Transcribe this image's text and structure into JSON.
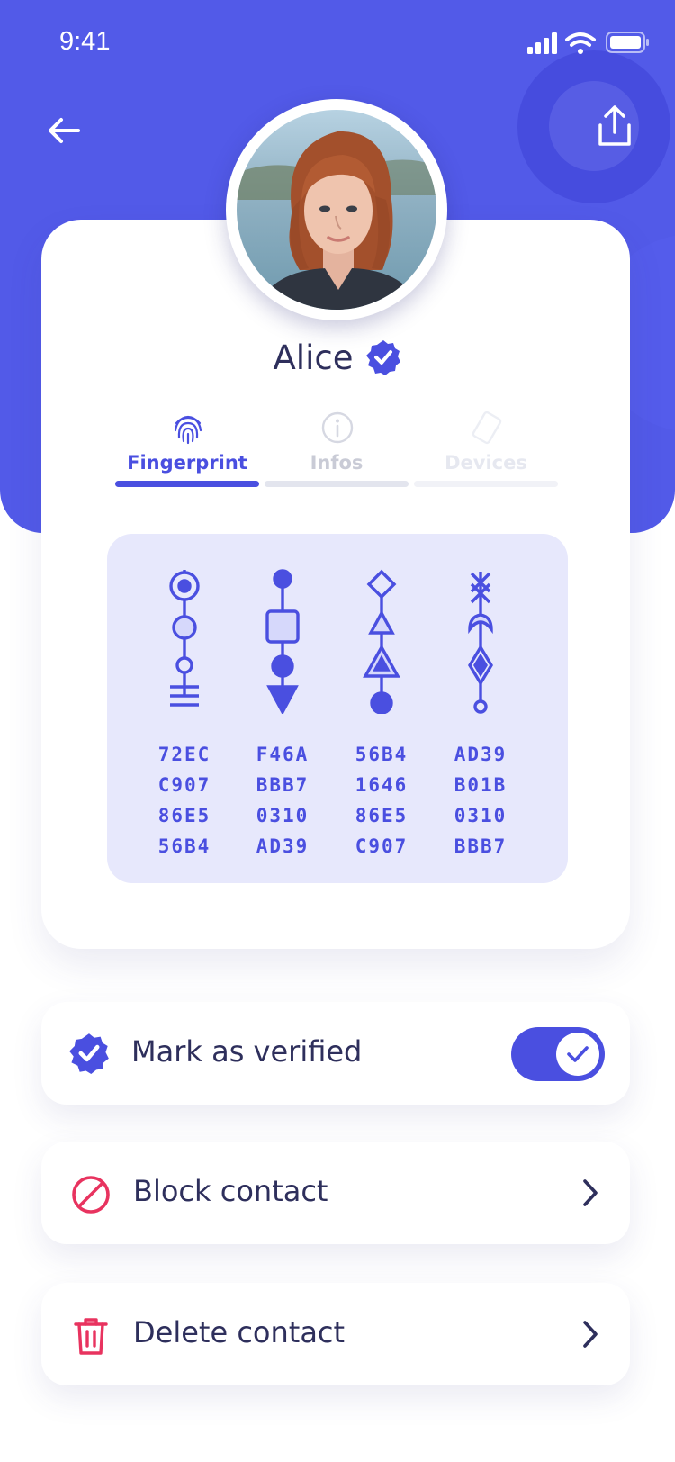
{
  "status_bar": {
    "time": "9:41"
  },
  "contact": {
    "name": "Alice"
  },
  "tabs": [
    {
      "label": "Fingerprint",
      "active": true
    },
    {
      "label": "Infos",
      "active": false
    },
    {
      "label": "Devices",
      "active": false
    }
  ],
  "fingerprint": {
    "columns": [
      [
        "72EC",
        "C907",
        "86E5",
        "56B4"
      ],
      [
        "F46A",
        "BBB7",
        "0310",
        "AD39"
      ],
      [
        "56B4",
        "1646",
        "86E5",
        "C907"
      ],
      [
        "AD39",
        "B01B",
        "0310",
        "BBB7"
      ]
    ]
  },
  "actions": {
    "verify_label": "Mark as verified",
    "verified_toggle_on": true,
    "block_label": "Block contact",
    "delete_label": "Delete contact"
  },
  "colors": {
    "brand": "#525ae8",
    "accent": "#4a4fe0",
    "danger": "#e8335f",
    "panel": "#e7e8fc"
  }
}
